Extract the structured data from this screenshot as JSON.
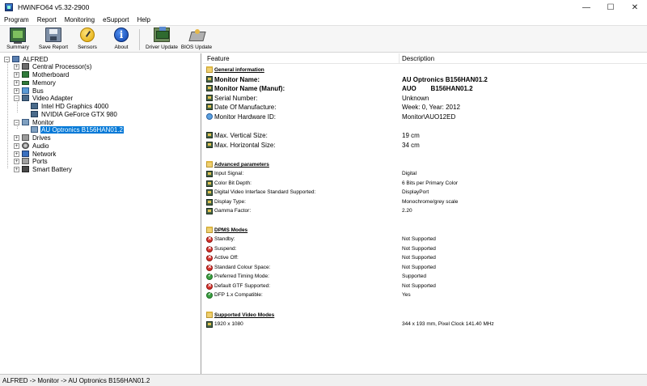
{
  "window": {
    "title": "HWiNFO64 v5.32-2900",
    "minimize": "—",
    "maximize": "☐",
    "close": "✕"
  },
  "menu": [
    "Program",
    "Report",
    "Monitoring",
    "eSupport",
    "Help"
  ],
  "toolbar": {
    "summary": "Summary",
    "save_report": "Save Report",
    "sensors": "Sensors",
    "about": "About",
    "driver_update": "Driver Update",
    "bios_update": "BIOS Update"
  },
  "tree": {
    "root": "ALFRED",
    "items": {
      "cpu": "Central Processor(s)",
      "motherboard": "Motherboard",
      "memory": "Memory",
      "bus": "Bus",
      "video_adapter": "Video Adapter",
      "gpu1": "Intel HD Graphics 4000",
      "gpu2": "NVIDIA GeForce GTX 980",
      "monitor": "Monitor",
      "monitor1": "AU Optronics B156HAN01.2",
      "drives": "Drives",
      "audio": "Audio",
      "network": "Network",
      "ports": "Ports",
      "battery": "Smart Battery"
    },
    "expand_symbol": "+",
    "collapse_symbol": "−"
  },
  "columns": {
    "feature": "Feature",
    "description": "Description"
  },
  "details": {
    "general": {
      "header": "General information",
      "monitor_name_label": "Monitor Name:",
      "monitor_name_value": "AU Optronics B156HAN01.2",
      "monitor_name_manuf_label": "Monitor Name (Manuf):",
      "monitor_name_manuf_value": "AUO        B156HAN01.2",
      "serial_label": "Serial Number:",
      "serial_value": "Unknown",
      "date_label": "Date Of Manufacture:",
      "date_value": "Week: 0, Year: 2012",
      "hwid_label": "Monitor Hardware ID:",
      "hwid_value": "Monitor\\AUO12ED",
      "vsize_label": "Max. Vertical Size:",
      "vsize_value": "19 cm",
      "hsize_label": "Max. Horizontal Size:",
      "hsize_value": "34 cm"
    },
    "advanced": {
      "header": "Advanced parameters",
      "input_signal_label": "Input Signal:",
      "input_signal_value": "Digital",
      "color_depth_label": "Color Bit Depth:",
      "color_depth_value": "6 Bits per Primary Color",
      "dvi_label": "Digital Video Interface Standard Supported:",
      "dvi_value": "DisplayPort",
      "display_type_label": "Display Type:",
      "display_type_value": "Monochrome/grey scale",
      "gamma_label": "Gamma Factor:",
      "gamma_value": "2.20"
    },
    "dpms": {
      "header": "DPMS Modes",
      "standby_label": "Standby:",
      "standby_value": "Not Supported",
      "suspend_label": "Suspend:",
      "suspend_value": "Not Supported",
      "active_off_label": "Active Off:",
      "active_off_value": "Not Supported",
      "std_colour_label": "Standard Colour Space:",
      "std_colour_value": "Not Supported",
      "preferred_label": "Preferred Timing Mode:",
      "preferred_value": "Supported",
      "gtf_label": "Default GTF Supported:",
      "gtf_value": "Not Supported",
      "dfp_label": "DFP 1.x Compatible:",
      "dfp_value": "Yes"
    },
    "video_modes": {
      "header": "Supported Video Modes",
      "mode1_label": "1920 x 1080",
      "mode1_value": "344 x 193 mm, Pixel Clock 141.40 MHz"
    }
  },
  "status_bar": "ALFRED -> Monitor -> AU Optronics B156HAN01.2",
  "colors": {
    "selection": "#0078d7",
    "toolbar_bg": "#f6f6f6",
    "status_bg": "#f0f0f0"
  }
}
